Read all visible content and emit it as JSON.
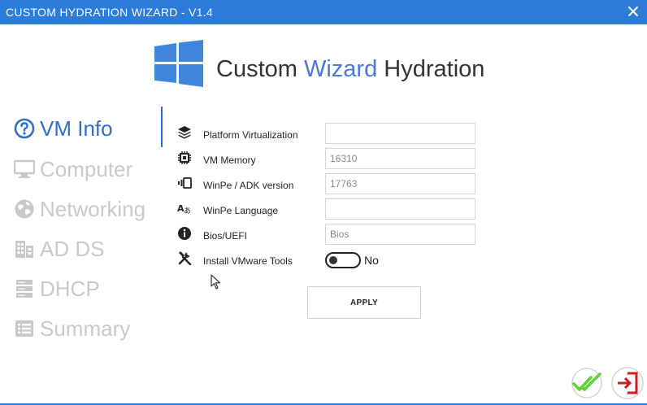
{
  "window": {
    "title": "CUSTOM HYDRATION WIZARD - V1.4",
    "accent_color": "#2b7bd8"
  },
  "brand": {
    "part1": "Custom ",
    "part2": "Wizard",
    "part3": " Hydration",
    "accent_color": "#4a78d6"
  },
  "nav": {
    "items": [
      {
        "label": "VM Info",
        "icon": "question-circle-icon",
        "active": true
      },
      {
        "label": "Computer",
        "icon": "monitor-icon",
        "active": false
      },
      {
        "label": "Networking",
        "icon": "network-globe-icon",
        "active": false
      },
      {
        "label": "AD DS",
        "icon": "building-icon",
        "active": false
      },
      {
        "label": "DHCP",
        "icon": "server-icon",
        "active": false
      },
      {
        "label": "Summary",
        "icon": "list-icon",
        "active": false
      }
    ]
  },
  "form": {
    "fields": [
      {
        "label": "Platform Virtualization",
        "icon": "layers-icon",
        "value": ""
      },
      {
        "label": "VM Memory",
        "icon": "chip-icon",
        "value": "16310"
      },
      {
        "label": "WinPe / ADK version",
        "icon": "version-icon",
        "value": "17763"
      },
      {
        "label": "WinPe Language",
        "icon": "language-icon",
        "value": ""
      },
      {
        "label": "Bios/UEFI",
        "icon": "info-icon",
        "value": "Bios"
      }
    ],
    "vmware_tools": {
      "label": "Install VMware Tools",
      "icon": "tools-icon",
      "state": "No",
      "enabled": false
    }
  },
  "buttons": {
    "apply": "APPLY",
    "ok_icon": "double-check-icon",
    "exit_icon": "exit-icon"
  }
}
